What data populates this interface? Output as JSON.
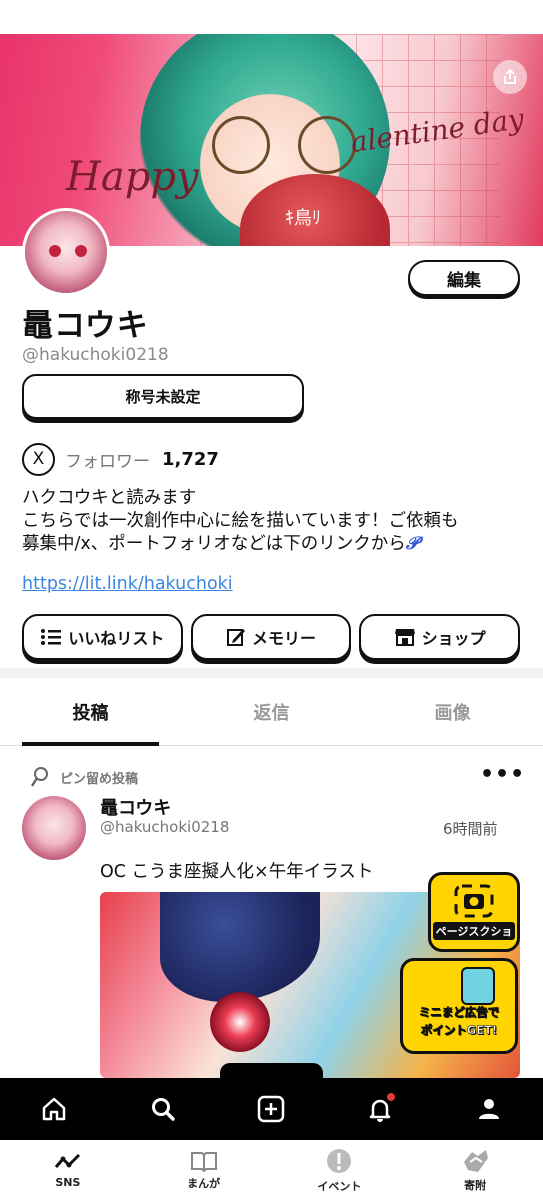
{
  "banner": {
    "script_left": "Happy",
    "script_right": "alentine day",
    "heart_text": "ｷ鳥ﾘ"
  },
  "profile": {
    "name": "鼂コウキ",
    "handle": "@hakuchoki0218",
    "edit_label": "編集",
    "title_badge": "称号未設定",
    "followers_label": "フォロワー",
    "followers_count": "1,727",
    "x_icon_label": "X",
    "bio_line1": "ハクコウキと読みます",
    "bio_line2": "こちらでは一次創作中心に絵を描いています！ご依頼も",
    "bio_line3": "募集中/x、ポートフォリオなどは下のリンクから",
    "bio_emoji": "𝒫",
    "link": "https://lit.link/hakuchoki"
  },
  "actions": [
    {
      "label": "いいねリスト",
      "icon": "list-icon"
    },
    {
      "label": "メモリー",
      "icon": "edit-icon"
    },
    {
      "label": "ショップ",
      "icon": "shop-icon"
    }
  ],
  "tabs": [
    {
      "label": "投稿",
      "active": true
    },
    {
      "label": "返信",
      "active": false
    },
    {
      "label": "画像",
      "active": false
    }
  ],
  "post": {
    "pin_label": "ピン留め投稿",
    "more": "•••",
    "author": "鼂コウキ",
    "handle": "@hakuchoki0218",
    "time": "6時間前",
    "text": "OC こうま座擬人化×午年イラスト"
  },
  "ads": {
    "screenshot_label": "ページスクショ",
    "promo_line1": "ミニまど広告で",
    "promo_line2": "ポイントGET!"
  },
  "footer": [
    {
      "label": "SNS",
      "icon": "sns-icon"
    },
    {
      "label": "まんが",
      "icon": "manga-icon"
    },
    {
      "label": "イベント",
      "icon": "event-icon"
    },
    {
      "label": "寄附",
      "icon": "donate-icon"
    }
  ],
  "colors": {
    "accent_link": "#3a86e0",
    "ad_yellow": "#ffd400",
    "notif_red": "#e53935"
  }
}
